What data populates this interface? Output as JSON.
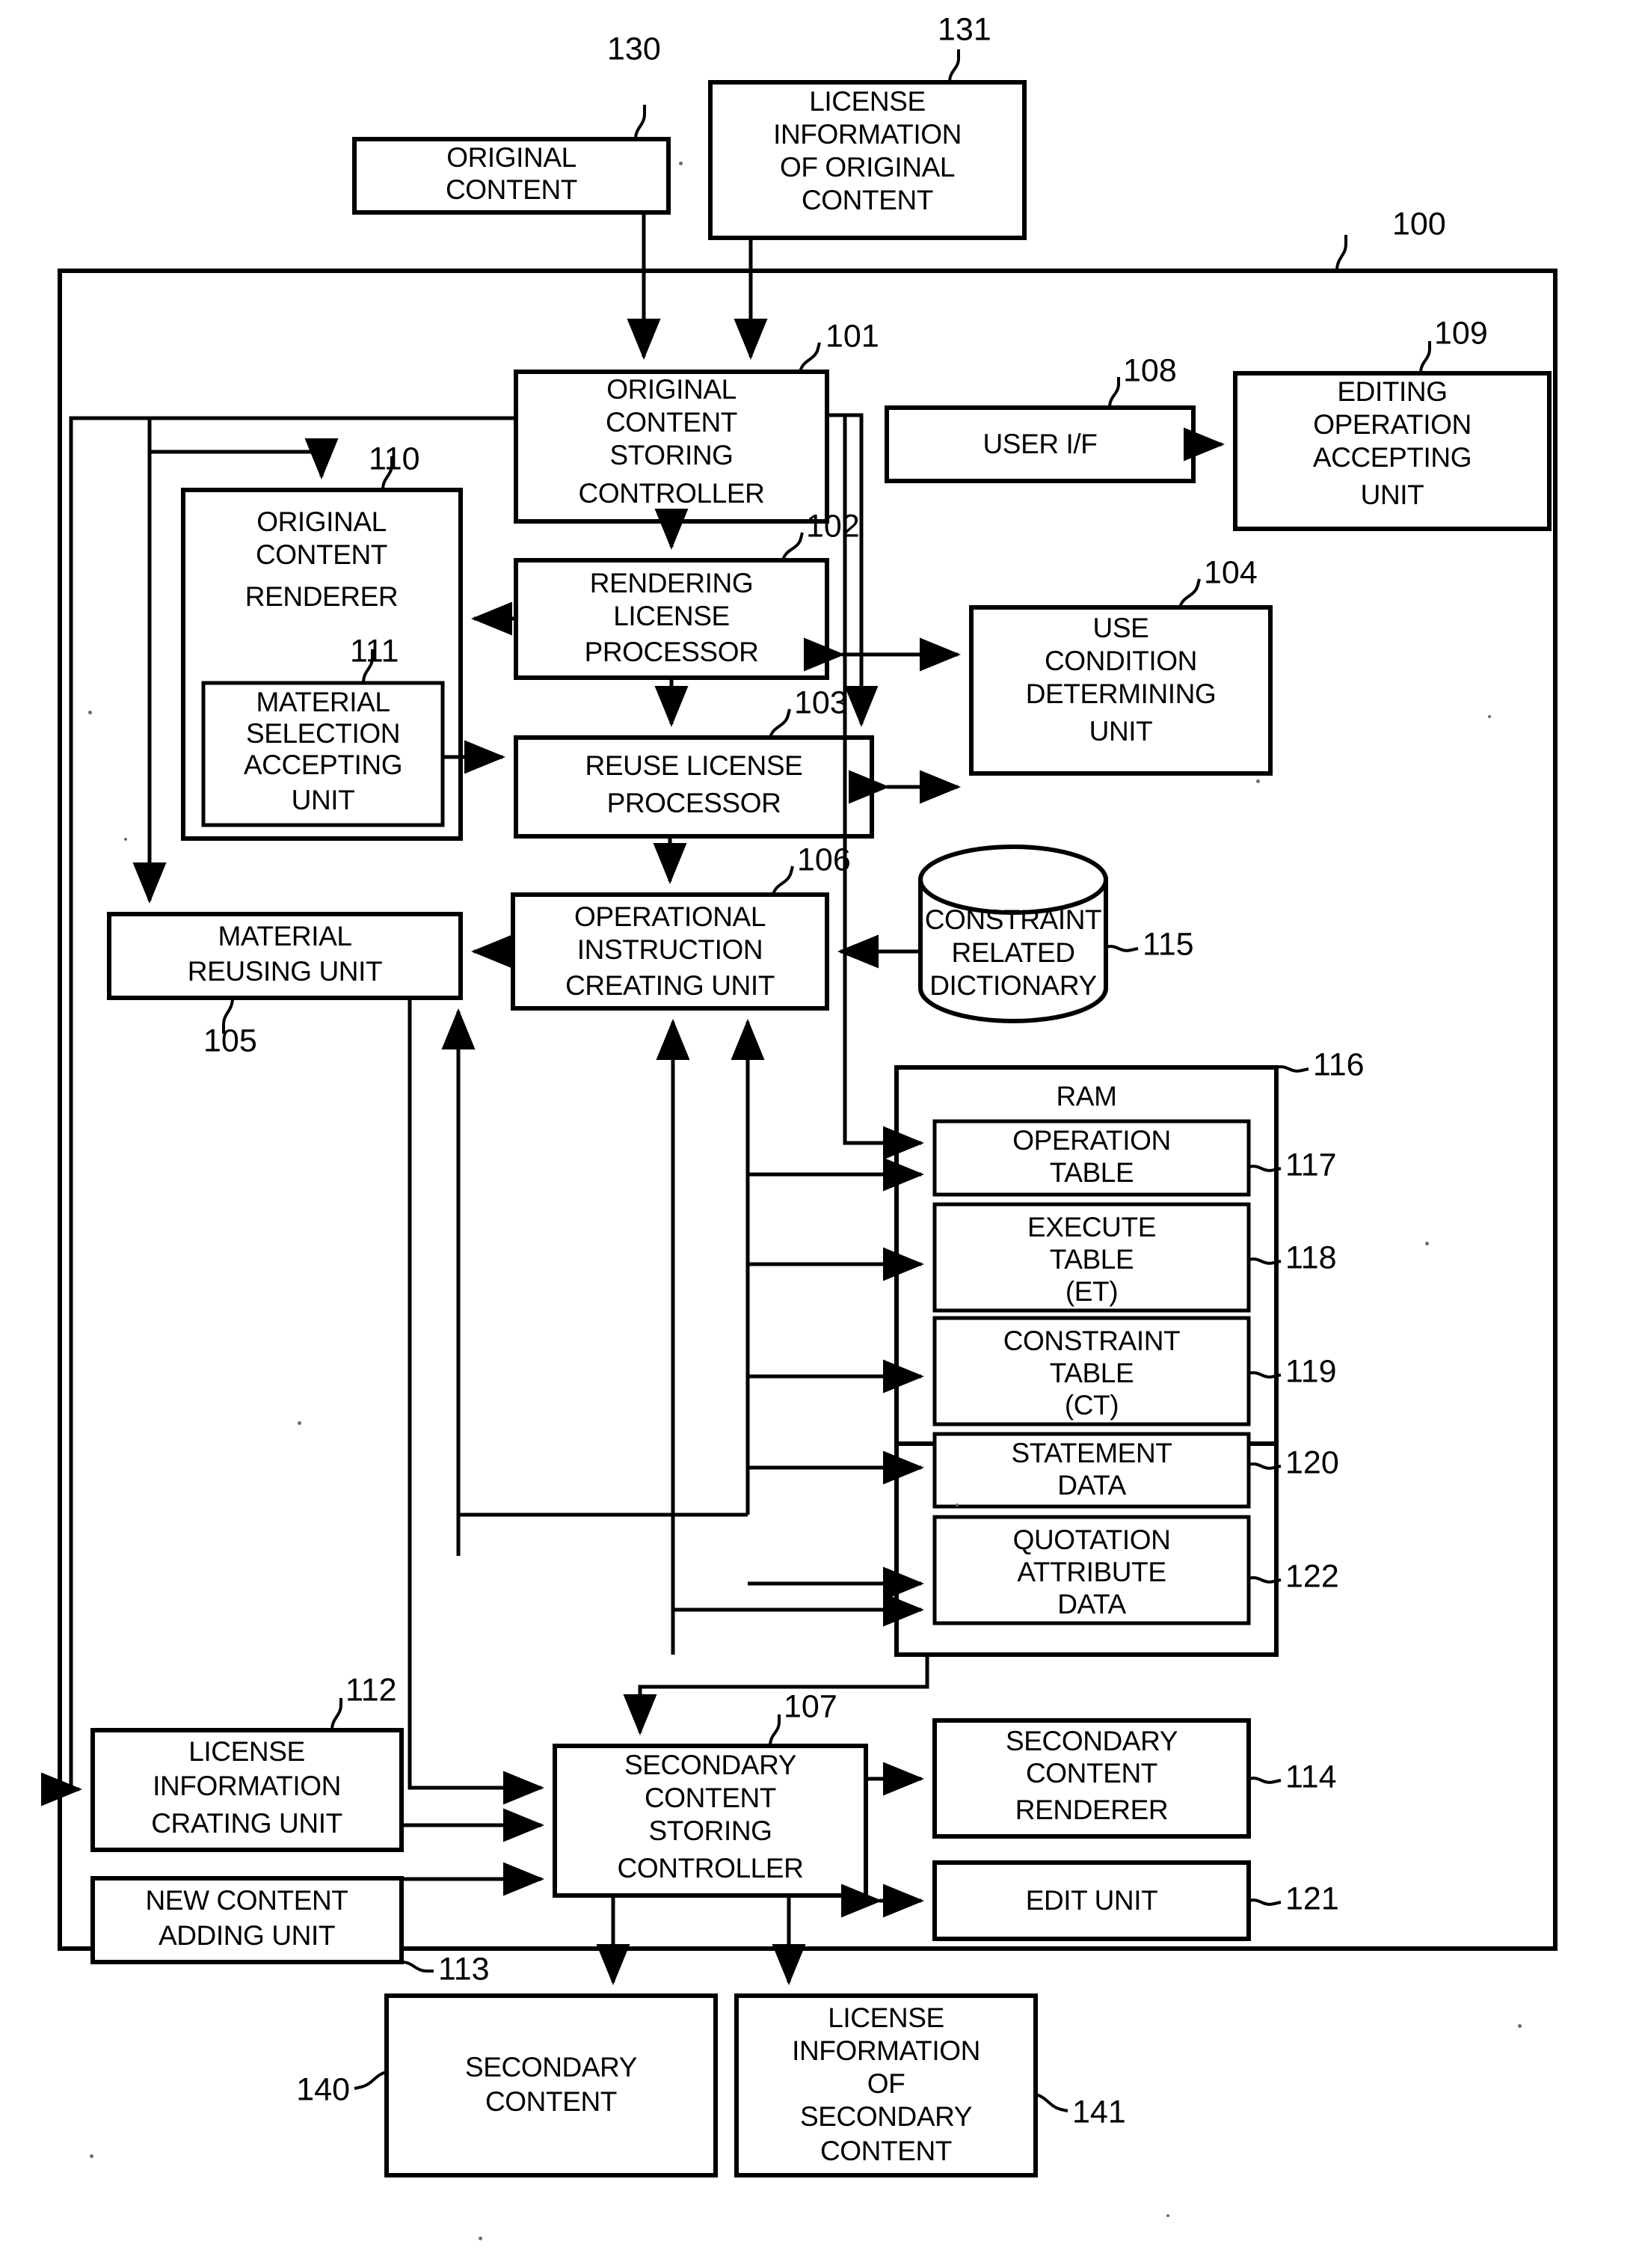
{
  "figure": {
    "type": "patent-block-diagram",
    "system_label": "100"
  },
  "blocks": [
    {
      "id": "b130",
      "ref": "130",
      "label": "ORIGINAL\nCONTENT",
      "shape": "rect"
    },
    {
      "id": "b131",
      "ref": "131",
      "label": "LICENSE\nINFORMATION\nOF ORIGINAL\nCONTENT",
      "shape": "rect"
    },
    {
      "id": "b101",
      "ref": "101",
      "label": "ORIGINAL\nCONTENT\nSTORING\nCONTROLLER",
      "shape": "rect"
    },
    {
      "id": "b108",
      "ref": "108",
      "label": "USER I/F",
      "shape": "rect"
    },
    {
      "id": "b109",
      "ref": "109",
      "label": "EDITING\nOPERATION\nACCEPTING\nUNIT",
      "shape": "rect"
    },
    {
      "id": "b110",
      "ref": "110",
      "label": "ORIGINAL\nCONTENT\nRENDERER",
      "shape": "rect"
    },
    {
      "id": "b111",
      "ref": "111",
      "label": "MATERIAL\nSELECTION\nACCEPTING\nUNIT",
      "shape": "rect"
    },
    {
      "id": "b102",
      "ref": "102",
      "label": "RENDERING\nLICENSE\nPROCESSOR",
      "shape": "rect"
    },
    {
      "id": "b104",
      "ref": "104",
      "label": "USE\nCONDITION\nDETERMINING\nUNIT",
      "shape": "rect"
    },
    {
      "id": "b103",
      "ref": "103",
      "label": "REUSE LICENSE\nPROCESSOR",
      "shape": "rect"
    },
    {
      "id": "b105",
      "ref": "105",
      "label": "MATERIAL\nREUSING UNIT",
      "shape": "rect"
    },
    {
      "id": "b106",
      "ref": "106",
      "label": "OPERATIONAL\nINSTRUCTION\nCREATING UNIT",
      "shape": "rect"
    },
    {
      "id": "b115",
      "ref": "115",
      "label": "CONSTRAINT\nRELATED\nDICTIONARY",
      "shape": "cylinder"
    },
    {
      "id": "b116",
      "ref": "116",
      "label": "RAM",
      "shape": "rect"
    },
    {
      "id": "b117",
      "ref": "117",
      "label": "OPERATION\nTABLE",
      "shape": "rect"
    },
    {
      "id": "b118",
      "ref": "118",
      "label": "EXECUTE\nTABLE\n(ET)",
      "shape": "rect"
    },
    {
      "id": "b119",
      "ref": "119",
      "label": "CONSTRAINT\nTABLE\n(CT)",
      "shape": "rect"
    },
    {
      "id": "b120",
      "ref": "120",
      "label": "STATEMENT\nDATA",
      "shape": "rect"
    },
    {
      "id": "b122",
      "ref": "122",
      "label": "QUOTATION\nATTRIBUTE\nDATA",
      "shape": "rect"
    },
    {
      "id": "b112",
      "ref": "112",
      "label": "LICENSE\nINFORMATION\nCRATING UNIT",
      "shape": "rect"
    },
    {
      "id": "b113",
      "ref": "113",
      "label": "NEW CONTENT\nADDING UNIT",
      "shape": "rect"
    },
    {
      "id": "b107",
      "ref": "107",
      "label": "SECONDARY\nCONTENT\nSTORING\nCONTROLLER",
      "shape": "rect"
    },
    {
      "id": "b114",
      "ref": "114",
      "label": "SECONDARY\nCONTENT\nRENDERER",
      "shape": "rect"
    },
    {
      "id": "b121",
      "ref": "121",
      "label": "EDIT UNIT",
      "shape": "rect"
    },
    {
      "id": "b140",
      "ref": "140",
      "label": "SECONDARY\nCONTENT",
      "shape": "rect"
    },
    {
      "id": "b141",
      "ref": "141",
      "label": "LICENSE\nINFORMATION\nOF\nSECONDARY\nCONTENT",
      "shape": "rect"
    }
  ],
  "text": {
    "original_content": "ORIGINAL CONTENT",
    "license_info_original": "LICENSE INFORMATION OF ORIGINAL CONTENT",
    "original_content_storing_controller": "ORIGINAL CONTENT STORING CONTROLLER",
    "user_if": "USER I/F",
    "editing_operation_accepting_unit": "EDITING OPERATION ACCEPTING UNIT",
    "original_content_renderer": "ORIGINAL CONTENT RENDERER",
    "material_selection_accepting_unit": "MATERIAL SELECTION ACCEPTING UNIT",
    "rendering_license_processor": "RENDERING LICENSE PROCESSOR",
    "use_condition_determining_unit": "USE CONDITION DETERMINING UNIT",
    "reuse_license_processor": "REUSE LICENSE PROCESSOR",
    "material_reusing_unit": "MATERIAL REUSING UNIT",
    "operational_instruction_creating_unit": "OPERATIONAL INSTRUCTION CREATING UNIT",
    "constraint_related_dictionary": "CONSTRAINT RELATED DICTIONARY",
    "ram": "RAM",
    "operation_table": "OPERATION TABLE",
    "execute_table": "EXECUTE TABLE (ET)",
    "constraint_table": "CONSTRAINT TABLE (CT)",
    "statement_data": "STATEMENT DATA",
    "quotation_attribute_data": "QUOTATION ATTRIBUTE DATA",
    "license_information_crating_unit": "LICENSE INFORMATION CRATING UNIT",
    "new_content_adding_unit": "NEW CONTENT ADDING UNIT",
    "secondary_content_storing_controller": "SECONDARY CONTENT STORING CONTROLLER",
    "secondary_content_renderer": "SECONDARY CONTENT RENDERER",
    "edit_unit": "EDIT UNIT",
    "secondary_content": "SECONDARY CONTENT",
    "license_info_secondary": "LICENSE INFORMATION OF SECONDARY CONTENT"
  },
  "lines": {
    "l130_1": "ORIGINAL",
    "l130_2": "CONTENT",
    "l131_1": "LICENSE",
    "l131_2": "INFORMATION",
    "l131_3": "OF ORIGINAL",
    "l131_4": "CONTENT",
    "l101_1": "ORIGINAL",
    "l101_2": "CONTENT",
    "l101_3": "STORING",
    "l101_4": "CONTROLLER",
    "l108_1": "USER I/F",
    "l109_1": "EDITING",
    "l109_2": "OPERATION",
    "l109_3": "ACCEPTING",
    "l109_4": "UNIT",
    "l110_1": "ORIGINAL",
    "l110_2": "CONTENT",
    "l110_3": "RENDERER",
    "l111_1": "MATERIAL",
    "l111_2": "SELECTION",
    "l111_3": "ACCEPTING",
    "l111_4": "UNIT",
    "l102_1": "RENDERING",
    "l102_2": "LICENSE",
    "l102_3": "PROCESSOR",
    "l104_1": "USE",
    "l104_2": "CONDITION",
    "l104_3": "DETERMINING",
    "l104_4": "UNIT",
    "l103_1": "REUSE LICENSE",
    "l103_2": "PROCESSOR",
    "l105_1": "MATERIAL",
    "l105_2": "REUSING UNIT",
    "l106_1": "OPERATIONAL",
    "l106_2": "INSTRUCTION",
    "l106_3": "CREATING UNIT",
    "l115_1": "CONSTRAINT",
    "l115_2": "RELATED",
    "l115_3": "DICTIONARY",
    "l116_1": "RAM",
    "l117_1": "OPERATION",
    "l117_2": "TABLE",
    "l118_1": "EXECUTE",
    "l118_2": "TABLE",
    "l118_3": "(ET)",
    "l119_1": "CONSTRAINT",
    "l119_2": "TABLE",
    "l119_3": "(CT)",
    "l120_1": "STATEMENT",
    "l120_2": "DATA",
    "l122_1": "QUOTATION",
    "l122_2": "ATTRIBUTE",
    "l122_3": "DATA",
    "l112_1": "LICENSE",
    "l112_2": "INFORMATION",
    "l112_3": "CRATING UNIT",
    "l113_1": "NEW CONTENT",
    "l113_2": "ADDING UNIT",
    "l107_1": "SECONDARY",
    "l107_2": "CONTENT",
    "l107_3": "STORING",
    "l107_4": "CONTROLLER",
    "l114_1": "SECONDARY",
    "l114_2": "CONTENT",
    "l114_3": "RENDERER",
    "l121_1": "EDIT UNIT",
    "l140_1": "SECONDARY",
    "l140_2": "CONTENT",
    "l141_1": "LICENSE",
    "l141_2": "INFORMATION",
    "l141_3": "OF",
    "l141_4": "SECONDARY",
    "l141_5": "CONTENT"
  },
  "refs": {
    "r100": "100",
    "r101": "101",
    "r102": "102",
    "r103": "103",
    "r104": "104",
    "r105": "105",
    "r106": "106",
    "r107": "107",
    "r108": "108",
    "r109": "109",
    "r110": "110",
    "r111": "111",
    "r112": "112",
    "r113": "113",
    "r114": "114",
    "r115": "115",
    "r116": "116",
    "r117": "117",
    "r118": "118",
    "r119": "119",
    "r120": "120",
    "r121": "121",
    "r122": "122",
    "r130": "130",
    "r131": "131",
    "r140": "140",
    "r141": "141"
  },
  "colors": {
    "ink": "#000000",
    "paper": "#ffffff"
  }
}
